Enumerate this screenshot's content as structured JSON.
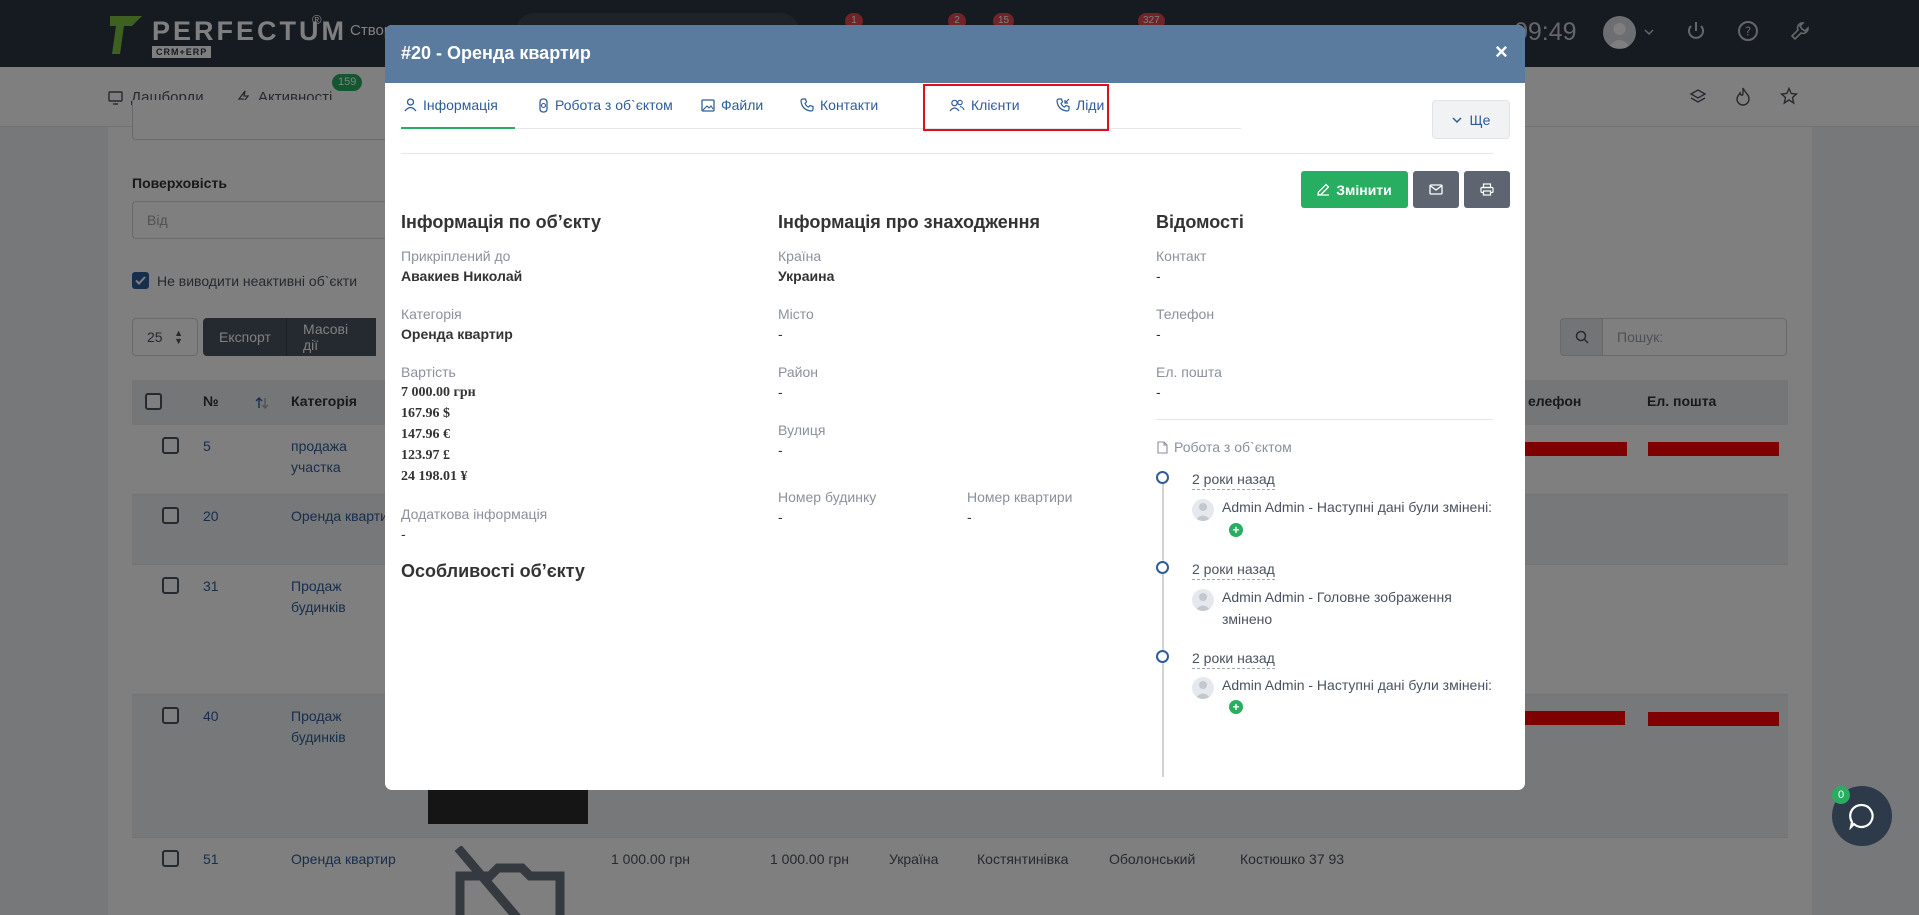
{
  "topbar": {
    "logo_text": "PERFECTUM",
    "logo_sub": "CRM+ERP",
    "logo_reg": "®",
    "create_label": "Створ",
    "badges": [
      "1",
      "2",
      "15",
      "327"
    ],
    "clock": "09:49"
  },
  "nav": {
    "dashboards": "Дашборди",
    "activities": "Активності",
    "activities_badge": "159"
  },
  "filters": {
    "surface_label": "Поверховість",
    "surface_from_placeholder": "Від",
    "inactive_label": "Не виводити неактивні об`єкти",
    "per_page": "25",
    "export_label": "Експорт",
    "bulk_label": "Масові дії",
    "search_placeholder": "Пошук:"
  },
  "table": {
    "headers": {
      "num": "№",
      "category": "Категорія",
      "phone": "елефон",
      "email": "Ел. пошта"
    },
    "rows": [
      {
        "id": "5",
        "category": "продажа участка"
      },
      {
        "id": "20",
        "category": "Оренда квартир"
      },
      {
        "id": "31",
        "category": "Продаж будинків"
      },
      {
        "id": "40",
        "category": "Продаж будинків"
      },
      {
        "id": "51",
        "category": "Оренда квартир",
        "price": "1 000.00 грн",
        "price2": "1 000.00 грн",
        "country": "Україна",
        "city": "Костянтинівка",
        "district": "Оболонський",
        "street": "Костюшко 37 93"
      }
    ]
  },
  "modal": {
    "title": "#20 - Оренда квартир",
    "close": "×",
    "tabs": [
      "Інформація",
      "Робота з об`єктом",
      "Файли",
      "Контакти",
      "Клієнти",
      "Ліди"
    ],
    "more_label": "Ще",
    "edit_label": "Змінити",
    "object_info": {
      "title": "Інформація по об’єкту",
      "attached_label": "Прикріплений до",
      "attached_value": "Авакиев Николай",
      "category_label": "Категорія",
      "category_value": "Оренда квартир",
      "cost_label": "Вартість",
      "cost_values": [
        "7 000.00 грн",
        "167.96 $",
        "147.96 €",
        "123.97 £",
        "24 198.01 ¥"
      ],
      "extra_label": "Додаткова інформація",
      "extra_value": "-",
      "features_title": "Особливості об’єкту"
    },
    "location_info": {
      "title": "Інформація про знаходження",
      "country_label": "Країна",
      "country_value": "Украина",
      "city_label": "Місто",
      "city_value": "-",
      "district_label": "Район",
      "district_value": "-",
      "street_label": "Вулиця",
      "street_value": "-",
      "house_label": "Номер будинку",
      "house_value": "-",
      "apartment_label": "Номер квартири",
      "apartment_value": "-"
    },
    "details": {
      "title": "Відомості",
      "contact_label": "Контакт",
      "contact_value": "-",
      "phone_label": "Телефон",
      "phone_value": "-",
      "email_label": "Ел. пошта",
      "email_value": "-",
      "timeline_title": "Робота з об`єктом",
      "timeline": [
        {
          "time": "2 роки назад",
          "text": "Admin Admin - Наступні дані були змінені:"
        },
        {
          "time": "2 роки назад",
          "text": "Admin Admin - Головне зображення змінено"
        },
        {
          "time": "2 роки назад",
          "text": "Admin Admin - Наступні дані були змінені:"
        }
      ]
    }
  },
  "chat": {
    "badge": "0"
  },
  "colors": {
    "accent": "#2e5c9a",
    "green": "#27ae60",
    "header": "#5a7a9e",
    "highlight": "#e0101a"
  }
}
